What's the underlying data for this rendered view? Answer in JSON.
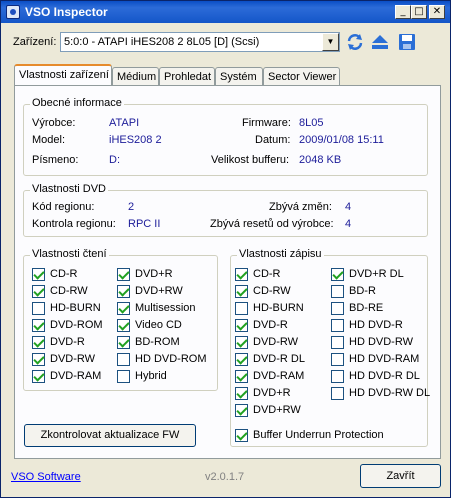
{
  "window": {
    "title": "VSO Inspector"
  },
  "device": {
    "label": "Zařízení:",
    "value": "5:0:0 - ATAPI iHES208   2 8L05 [D] (Scsi)"
  },
  "tabs": [
    "Vlastnosti zařízení",
    "Médium",
    "Prohledat",
    "Systém",
    "Sector Viewer"
  ],
  "general": {
    "title": "Obecné informace",
    "vendor_label": "Výrobce:",
    "vendor": "ATAPI",
    "model_label": "Model:",
    "model": "iHES208   2",
    "letter_label": "Písmeno:",
    "letter": "D:",
    "firmware_label": "Firmware:",
    "firmware": "8L05",
    "date_label": "Datum:",
    "date": "2009/01/08 15:11",
    "buffer_label": "Velikost bufferu:",
    "buffer": "2048 KB"
  },
  "dvd": {
    "title": "Vlastnosti DVD",
    "region_code_label": "Kód regionu:",
    "region_code": "2",
    "region_control_label": "Kontrola regionu:",
    "region_control": "RPC II",
    "changes_left_label": "Zbývá změn:",
    "changes_left": "4",
    "resets_left_label": "Zbývá resetů od výrobce:",
    "resets_left": "4"
  },
  "read": {
    "title": "Vlastnosti čtení",
    "col1": [
      {
        "label": "CD-R",
        "checked": true
      },
      {
        "label": "CD-RW",
        "checked": true
      },
      {
        "label": "HD-BURN",
        "checked": false
      },
      {
        "label": "DVD-ROM",
        "checked": true
      },
      {
        "label": "DVD-R",
        "checked": true
      },
      {
        "label": "DVD-RW",
        "checked": true
      },
      {
        "label": "DVD-RAM",
        "checked": true
      }
    ],
    "col2": [
      {
        "label": "DVD+R",
        "checked": true
      },
      {
        "label": "DVD+RW",
        "checked": true
      },
      {
        "label": "Multisession",
        "checked": true
      },
      {
        "label": "Video CD",
        "checked": true
      },
      {
        "label": "BD-ROM",
        "checked": true
      },
      {
        "label": "HD DVD-ROM",
        "checked": false
      },
      {
        "label": "Hybrid",
        "checked": false
      }
    ]
  },
  "write": {
    "title": "Vlastnosti zápisu",
    "col1": [
      {
        "label": "CD-R",
        "checked": true
      },
      {
        "label": "CD-RW",
        "checked": true
      },
      {
        "label": "HD-BURN",
        "checked": false
      },
      {
        "label": "DVD-R",
        "checked": true
      },
      {
        "label": "DVD-RW",
        "checked": true
      },
      {
        "label": "DVD-R DL",
        "checked": true
      },
      {
        "label": "DVD-RAM",
        "checked": true
      },
      {
        "label": "DVD+R",
        "checked": true
      },
      {
        "label": "DVD+RW",
        "checked": true
      }
    ],
    "col2": [
      {
        "label": "DVD+R DL",
        "checked": true
      },
      {
        "label": "BD-R",
        "checked": false
      },
      {
        "label": "BD-RE",
        "checked": false
      },
      {
        "label": "HD DVD-R",
        "checked": false
      },
      {
        "label": "HD DVD-RW",
        "checked": false
      },
      {
        "label": "HD DVD-RAM",
        "checked": false
      },
      {
        "label": "HD DVD-R DL",
        "checked": false
      },
      {
        "label": "HD DVD-RW DL",
        "checked": false
      }
    ],
    "buffer_underrun": {
      "label": "Buffer Underrun Protection",
      "checked": true
    }
  },
  "fw_button": "Zkontrolovat aktualizace FW",
  "footer": {
    "link": "VSO Software",
    "version": "v2.0.1.7",
    "close": "Zavřít"
  }
}
